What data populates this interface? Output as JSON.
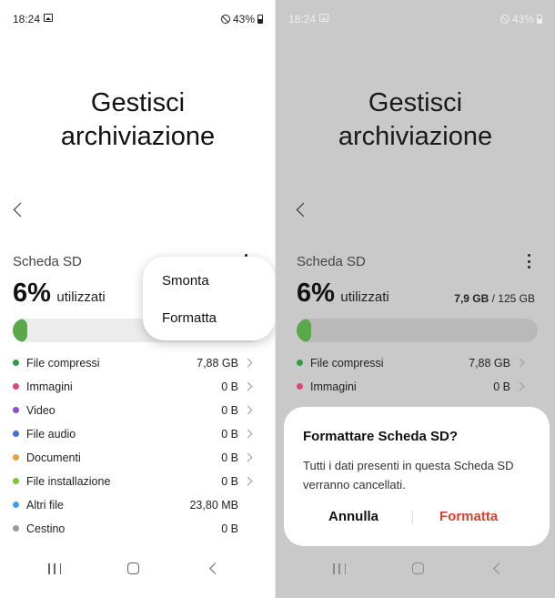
{
  "status_bar": {
    "time": "18:24",
    "battery": "43%"
  },
  "title_line1": "Gestisci",
  "title_line2": "archiviazione",
  "storage": {
    "label": "Scheda SD",
    "percent": "6%",
    "used_label": "utilizzati",
    "used_amount": "7,9 GB",
    "total_amount": "/ 125 GB",
    "usage_fraction": 0.06
  },
  "categories": [
    {
      "name": "File compressi",
      "size": "7,88 GB",
      "color": "#2e9e3f"
    },
    {
      "name": "Immagini",
      "size": "0 B",
      "color": "#d8467a"
    },
    {
      "name": "Video",
      "size": "0 B",
      "color": "#8a4fd0"
    },
    {
      "name": "File audio",
      "size": "0 B",
      "color": "#3f6fd9"
    },
    {
      "name": "Documenti",
      "size": "0 B",
      "color": "#e3a33a"
    },
    {
      "name": "File installazione",
      "size": "0 B",
      "color": "#78c832"
    },
    {
      "name": "Altri file",
      "size": "23,80 MB",
      "color": "#3aa3e8"
    },
    {
      "name": "Cestino",
      "size": "0 B",
      "color": "#9b9b9b"
    }
  ],
  "popup_menu": {
    "unmount": "Smonta",
    "format": "Formatta"
  },
  "dialog": {
    "title": "Formattare Scheda SD?",
    "message": "Tutti i dati presenti in questa Scheda SD verranno cancellati.",
    "cancel": "Annulla",
    "confirm": "Formatta"
  },
  "colors": {
    "accent_green": "#5aa84a",
    "danger_red": "#d7402f",
    "dim_overlay": "#c9c9c9"
  },
  "icons": [
    "image-icon",
    "dnd-icon",
    "battery-icon",
    "back-arrow-icon",
    "more-options-icon",
    "chevron-right-icon",
    "recents-icon",
    "home-icon",
    "nav-back-icon"
  ]
}
